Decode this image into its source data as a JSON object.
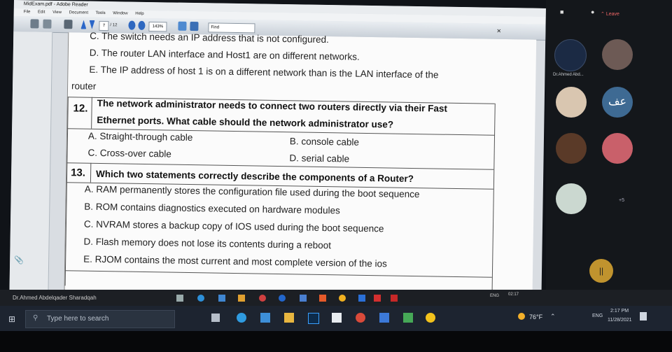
{
  "reader": {
    "title": "MidExam.pdf - Adobe Reader",
    "menu": [
      "File",
      "Edit",
      "View",
      "Document",
      "Tools",
      "Window",
      "Help"
    ],
    "page_current": "7",
    "page_total": "/ 12",
    "zoom": "143%",
    "find_placeholder": "Find"
  },
  "document": {
    "q11_tail": [
      "C. The switch needs an IP address that is not configured.",
      "D. The router LAN interface and Host1 are on different networks.",
      "E. The IP address of host 1 is on a different network than is the LAN interface of the",
      "router"
    ],
    "q12": {
      "number": "12.",
      "text_line1": "The network administrator needs to connect two routers directly via their Fast",
      "text_line2": "Ethernet ports. What cable should the network administrator use?",
      "options": [
        "A. Straight-through  cable",
        "B. console cable",
        "C. Cross-over cable",
        "D. serial cable"
      ]
    },
    "q13": {
      "number": "13.",
      "text": "Which two statements correctly describe the components of a Router?",
      "options": [
        "A. RAM permanently stores the configuration file used during the boot sequence",
        "B. ROM contains diagnostics executed on hardware modules",
        "C. NVRAM stores a backup copy of IOS used during the boot sequence",
        "D. Flash memory does not lose its contents during a reboot",
        "E. RJOM contains the most current and most complete version of the ios"
      ]
    }
  },
  "zoom": {
    "leave_label": "Leave",
    "participants": [
      {
        "name": "Dr.Ahmed Abd...",
        "color": "#1b2a44"
      },
      {
        "name": "...",
        "color": "#6d5a55"
      },
      {
        "name": "...",
        "color": "#d9c6b0"
      },
      {
        "name": "...",
        "color": "#3e6a93"
      },
      {
        "name": "...",
        "color": "#5a3a28"
      },
      {
        "name": "...",
        "color": "#c9606a"
      },
      {
        "name": "...",
        "color": "#cbd8d0"
      }
    ],
    "avatar_initials": "عف",
    "extra_count": "+5",
    "pause_icon": "||",
    "presenter_label": "Dr.Ahmed Abdelqader Sharadqah",
    "inner_clock": "02:17",
    "inner_lang": "ENG"
  },
  "taskbar": {
    "search_placeholder": "Type here to search",
    "weather": "76°F",
    "lang": "ENG",
    "time": "2:17 PM",
    "date": "11/28/2021"
  }
}
